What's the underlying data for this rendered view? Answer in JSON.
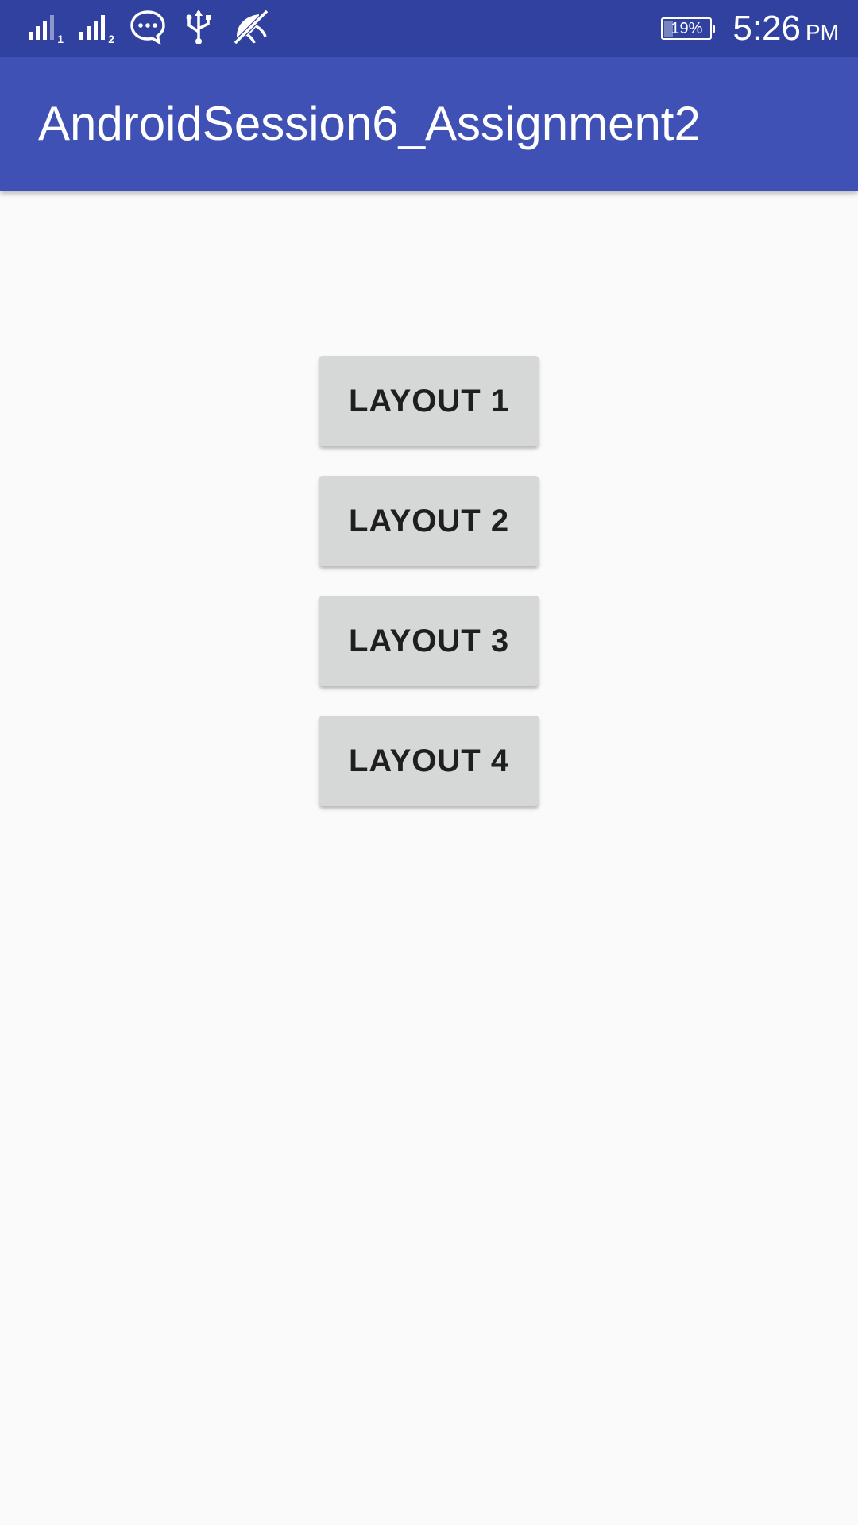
{
  "status_bar": {
    "sim1_label": "1",
    "sim2_label": "2",
    "icons": [
      "signal-icon",
      "signal-icon",
      "message-icon",
      "usb-icon",
      "no-location-icon"
    ],
    "battery_percent": "19%",
    "battery_level": 0.19,
    "time": "5:26",
    "ampm": "PM"
  },
  "app_bar": {
    "title": "AndroidSession6_Assignment2",
    "color": "#3f51b5",
    "status_color": "#3041a0"
  },
  "buttons": [
    {
      "label": "LAYOUT 1"
    },
    {
      "label": "LAYOUT 2"
    },
    {
      "label": "LAYOUT 3"
    },
    {
      "label": "LAYOUT 4"
    }
  ]
}
